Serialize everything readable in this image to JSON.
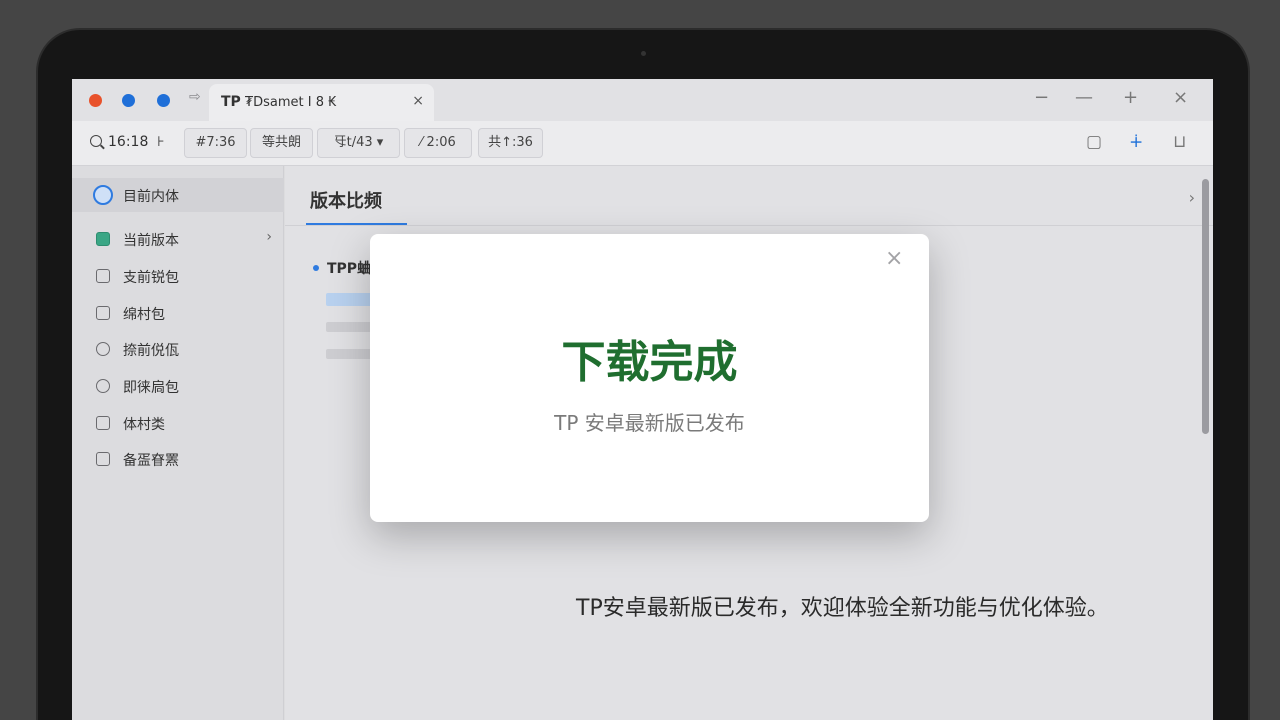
{
  "window": {
    "tab_logo": "TP",
    "tab_title": "₮Dsamet I 8 ₭",
    "tab_close": "×",
    "nav_arrow": "⇨",
    "controls": [
      "−",
      "—",
      "+",
      "×"
    ]
  },
  "toolbar": {
    "search_value": "16:18",
    "search_suffix": "⊦",
    "chips": [
      "#7:36",
      "等共朗",
      "㸦t/43 ▾",
      "⁄ 2:06",
      "共↑:36"
    ]
  },
  "sidebar": {
    "items": [
      {
        "label": "目前内体"
      },
      {
        "label": "当前版本",
        "chevron": "›"
      },
      {
        "label": "支前锐包"
      },
      {
        "label": "绵村包"
      },
      {
        "label": "捺前侻佤"
      },
      {
        "label": "即徕扃包"
      },
      {
        "label": "体村类"
      },
      {
        "label": "备㿿眘罴"
      }
    ]
  },
  "main": {
    "title": "版本比频",
    "chevron": "›",
    "section_title": "TPP蛐",
    "bottom_text": "TP安卓最新版已发布，欢迎体验全新功能与优化体验。"
  },
  "modal": {
    "close": "×",
    "title": "下载完成",
    "subtitle": "TP 安卓最新版已发布"
  },
  "colors": {
    "accent_blue": "#2f7be0",
    "modal_title_green": "#1f6e2f",
    "close_red": "#e8522b"
  }
}
